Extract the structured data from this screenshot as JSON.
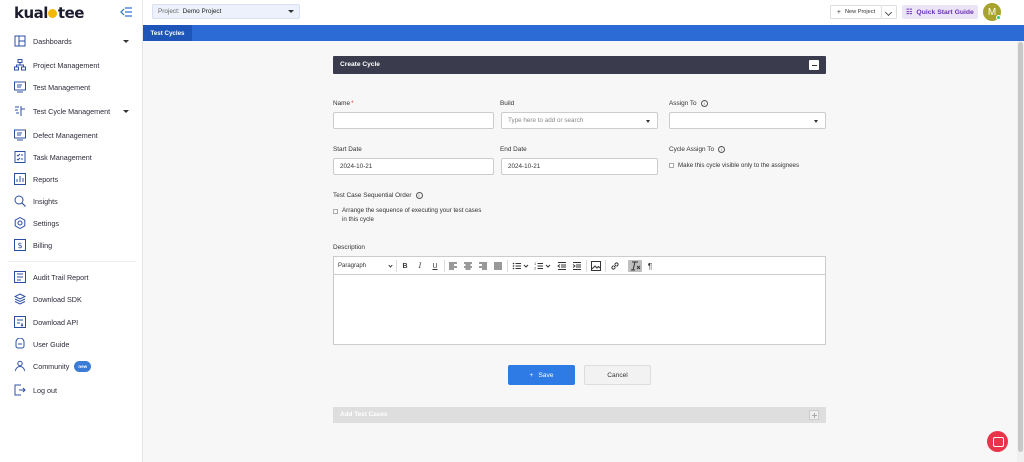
{
  "logo": {
    "prefix": "kual",
    "suffix": "tee"
  },
  "sidebar": {
    "items": [
      {
        "label": "Dashboards",
        "icon": "dashboard-icon"
      },
      {
        "label": "Project Management",
        "icon": "hierarchy-icon"
      },
      {
        "label": "Test Management",
        "icon": "monitor-icon"
      },
      {
        "label": "Test Cycle Management",
        "icon": "cycle-icon"
      },
      {
        "label": "Defect Management",
        "icon": "monitor-icon"
      },
      {
        "label": "Task Management",
        "icon": "task-icon"
      },
      {
        "label": "Reports",
        "icon": "report-icon"
      },
      {
        "label": "Insights",
        "icon": "insights-icon"
      },
      {
        "label": "Settings",
        "icon": "gear-icon"
      },
      {
        "label": "Billing",
        "icon": "billing-icon"
      },
      {
        "label": "Audit Trail Report",
        "icon": "audit-icon"
      },
      {
        "label": "Download SDK",
        "icon": "layers-icon"
      },
      {
        "label": "Download API",
        "icon": "api-icon"
      },
      {
        "label": "User Guide",
        "icon": "guide-icon"
      },
      {
        "label": "Community",
        "icon": "community-icon",
        "badge": "new"
      },
      {
        "label": "Log out",
        "icon": "logout-icon"
      }
    ]
  },
  "topbar": {
    "project_label": "Project:",
    "project_value": "Demo Project",
    "new_project": "New Project",
    "quick_start": "Quick Start Guide",
    "avatar_initial": "M"
  },
  "tabs": {
    "active": "Test Cycles"
  },
  "form": {
    "panel_title": "Create Cycle",
    "name_label": "Name",
    "name_required": "*",
    "name_value": "",
    "build_label": "Build",
    "build_placeholder": "Type here to add or search",
    "assign_label": "Assign To",
    "start_label": "Start Date",
    "start_value": "2024-10-21",
    "end_label": "End Date",
    "end_value": "2024-10-21",
    "cycle_assign_label": "Cycle Assign To",
    "cycle_assign_check": "Make this cycle visible only to the assignees",
    "sequential_label": "Test Case Sequential Order",
    "sequential_check_line1": "Arrange the sequence of executing your test cases",
    "sequential_check_line2": "in this cycle",
    "description_label": "Description",
    "editor_paragraph": "Paragraph",
    "save": "Save",
    "save_prefix": "+",
    "cancel": "Cancel",
    "add_test_cases": "Add Test Cases"
  },
  "colors": {
    "accent": "#2c6bd6",
    "panel": "#3b3b4e",
    "quick_start_text": "#6a2fb4",
    "chat": "#e8354a"
  }
}
